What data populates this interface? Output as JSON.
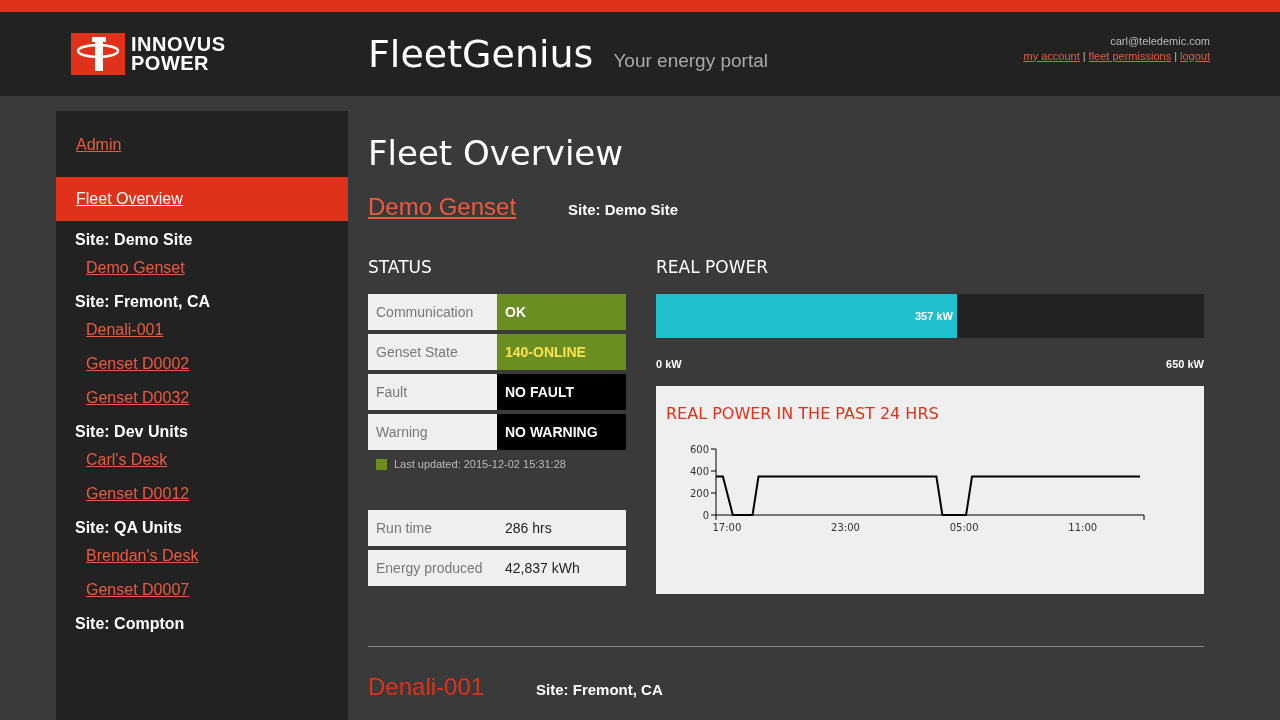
{
  "header": {
    "logo": {
      "line1": "INNOVUS",
      "line2": "POWER"
    },
    "app_title": "FleetGenius",
    "tagline": "Your energy portal",
    "user_email": "carl@teledemic.com",
    "links": [
      "my account",
      "fleet permissions",
      "logout"
    ],
    "separator": "|"
  },
  "sidebar": {
    "nav": [
      {
        "label": "Admin",
        "selected": false
      },
      {
        "label": "Fleet Overview",
        "selected": true
      }
    ],
    "sites": [
      {
        "label": "Site: Demo Site",
        "units": [
          "Demo Genset"
        ]
      },
      {
        "label": "Site: Fremont, CA",
        "units": [
          "Denali-001",
          "Genset D0002",
          "Genset D0032"
        ]
      },
      {
        "label": "Site: Dev Units",
        "units": [
          "Carl's Desk",
          "Genset D0012"
        ]
      },
      {
        "label": "Site: QA Units",
        "units": [
          "Brendan's Desk",
          "Genset D0007"
        ]
      },
      {
        "label": "Site: Compton"
      }
    ]
  },
  "main": {
    "page_title": "Fleet Overview",
    "gensets": [
      {
        "name": "Demo Genset",
        "site": "Site: Demo Site",
        "status_title": "STATUS",
        "status": [
          {
            "label": "Communication",
            "value": "OK",
            "kind": "ok"
          },
          {
            "label": "Genset State",
            "value": "140-ONLINE",
            "kind": "online"
          },
          {
            "label": "Fault",
            "value": "NO FAULT",
            "kind": "neutral"
          },
          {
            "label": "Warning",
            "value": "NO WARNING",
            "kind": "neutral"
          }
        ],
        "last_updated": "Last updated: 2015-12-02 15:31:28",
        "stats": [
          {
            "label": "Run time",
            "value": "286 hrs"
          },
          {
            "label": "Energy produced",
            "value": "42,837 kWh"
          }
        ],
        "power": {
          "title": "REAL POWER",
          "level": 0.549,
          "reading": "357 kW",
          "min": "0 kW",
          "max": "650 kW"
        },
        "chart": {
          "title": "REAL POWER IN THE PAST 24 HRS",
          "chart_data": {
            "type": "line",
            "x": [
              "2015-12-01T16:27",
              "2015-12-01T16:48",
              "2015-12-01T17:18",
              "2015-12-01T18:18",
              "2015-12-01T18:36",
              "2015-12-02T03:36",
              "2015-12-02T03:54",
              "2015-12-02T05:06",
              "2015-12-02T05:24",
              "2015-12-02T13:54"
            ],
            "series": [
              {
                "color": "#000000",
                "values": [
                  350,
                  350,
                  0,
                  0,
                  350,
                  350,
                  0,
                  0,
                  350,
                  350
                ]
              }
            ],
            "xlim": [
              "2015-12-01T16:27",
              "2015-12-02T14:06"
            ],
            "ylim": [
              0,
              600
            ],
            "yticks": [
              0,
              200,
              400,
              600
            ],
            "xticks": [
              {
                "value": "2015-12-01T17:00",
                "label": "17:00"
              },
              {
                "value": "2015-12-01T23:00",
                "label": "23:00"
              },
              {
                "value": "2015-12-02T05:00",
                "label": "05:00"
              },
              {
                "value": "2015-12-02T11:00",
                "label": "11:00"
              }
            ]
          }
        }
      },
      {
        "name": "Denali-001",
        "site": "Site: Fremont, CA"
      }
    ]
  }
}
